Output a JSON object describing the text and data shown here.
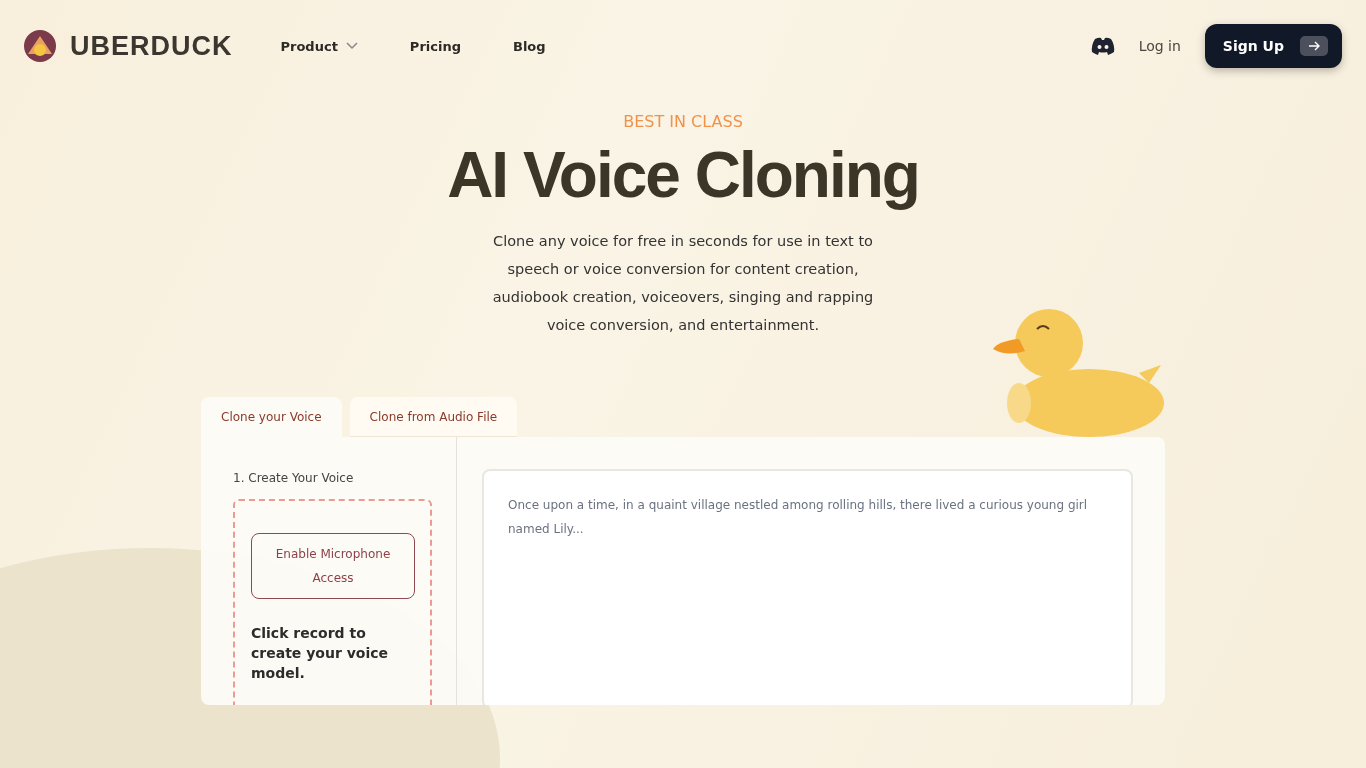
{
  "nav": {
    "brand": "UBERDUCK",
    "links": [
      {
        "label": "Product",
        "dropdown": true
      },
      {
        "label": "Pricing",
        "dropdown": false
      },
      {
        "label": "Blog",
        "dropdown": false
      }
    ],
    "login": "Log in",
    "signup": "Sign Up"
  },
  "hero": {
    "eyebrow": "BEST IN CLASS",
    "title": "AI Voice Cloning",
    "description": "Clone any voice for free in seconds for use in text to speech or voice conversion for content creation, audiobook creation, voiceovers, singing and rapping voice conversion, and entertainment."
  },
  "tabs": [
    {
      "label": "Clone your Voice",
      "selected": true
    },
    {
      "label": "Clone from Audio File",
      "selected": false
    }
  ],
  "panel": {
    "step": "1. Create Your Voice",
    "mic_button": "Enable Microphone Access",
    "instruction": "Click record to create your voice model.",
    "script_placeholder": "Once upon a time, in a quaint village nestled among rolling hills, there lived a curious young girl named Lily..."
  }
}
